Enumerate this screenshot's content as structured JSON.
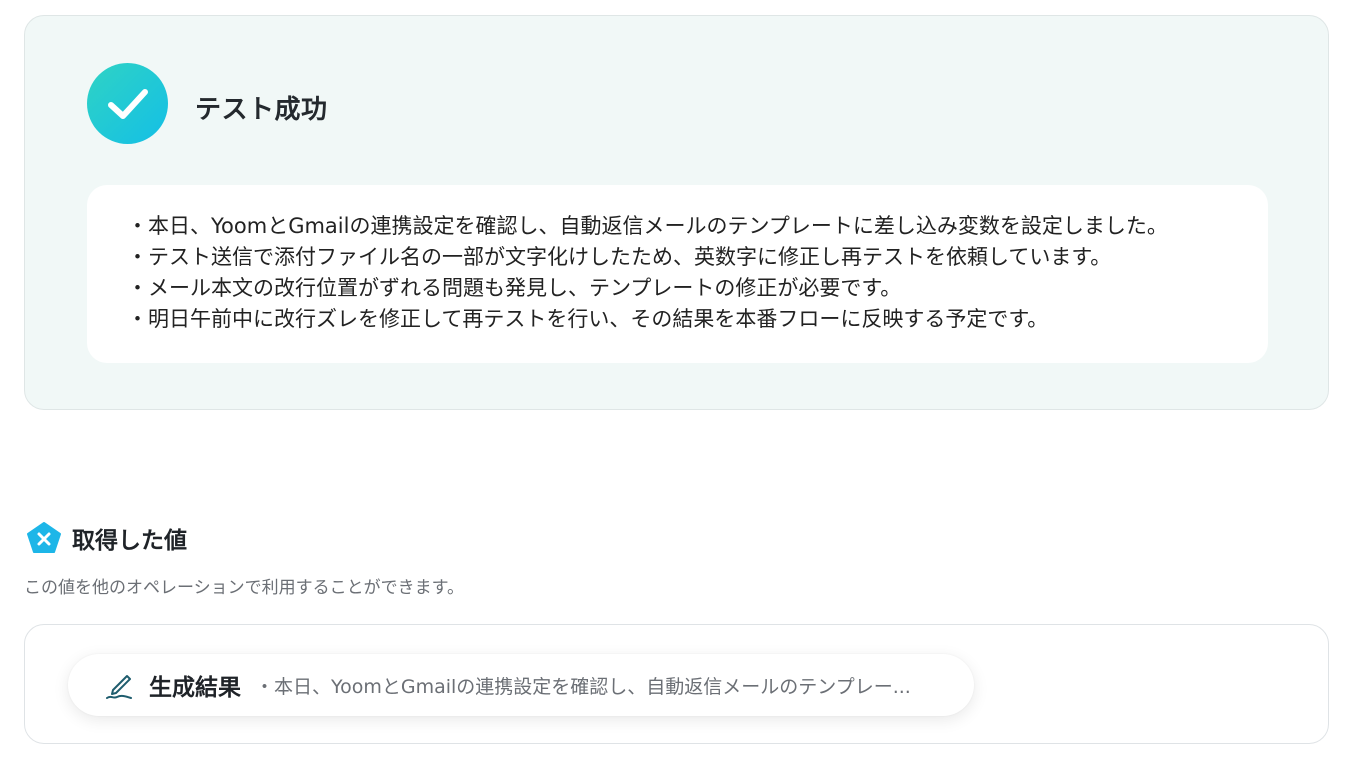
{
  "success": {
    "title": "テスト成功",
    "icon": "check-icon",
    "accent_colors": [
      "#2fd3c4",
      "#14bfe6"
    ],
    "lines": [
      "・本日、YoomとGmailの連携設定を確認し、自動返信メールのテンプレートに差し込み変数を設定しました。",
      "・テスト送信で添付ファイル名の一部が文字化けしたため、英数字に修正し再テストを依頼しています。",
      "・メール本文の改行位置がずれる問題も発見し、テンプレートの修正が必要です。",
      "・明日午前中に改行ズレを修正して再テストを行い、その結果を本番フローに反映する予定です。"
    ]
  },
  "obtained": {
    "title": "取得した値",
    "icon": "variable-icon",
    "description": "この値を他のオペレーションで利用することができます。"
  },
  "result": {
    "label": "生成結果",
    "icon": "pen-icon",
    "value": "・本日、YoomとGmailの連携設定を確認し、自動返信メールのテンプレー..."
  }
}
